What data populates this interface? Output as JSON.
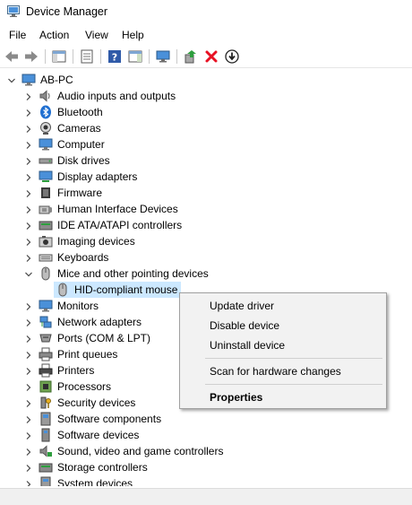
{
  "window": {
    "title": "Device Manager"
  },
  "menu": [
    "File",
    "Action",
    "View",
    "Help"
  ],
  "toolbar_icons": [
    "back-arrow-icon",
    "forward-arrow-icon",
    "show-hide-console-tree-icon",
    "properties-sheet-icon",
    "help-icon",
    "action-pane-icon",
    "monitor-icon",
    "update-driver-icon",
    "uninstall-device-icon",
    "download-icon"
  ],
  "tree": {
    "root": "AB-PC",
    "categories": [
      {
        "label": "Audio inputs and outputs",
        "icon": "speaker-icon"
      },
      {
        "label": "Bluetooth",
        "icon": "bluetooth-icon"
      },
      {
        "label": "Cameras",
        "icon": "camera-icon"
      },
      {
        "label": "Computer",
        "icon": "computer-icon"
      },
      {
        "label": "Disk drives",
        "icon": "disk-drive-icon"
      },
      {
        "label": "Display adapters",
        "icon": "display-adapter-icon"
      },
      {
        "label": "Firmware",
        "icon": "firmware-icon"
      },
      {
        "label": "Human Interface Devices",
        "icon": "hid-icon"
      },
      {
        "label": "IDE ATA/ATAPI controllers",
        "icon": "ide-controller-icon"
      },
      {
        "label": "Imaging devices",
        "icon": "imaging-icon"
      },
      {
        "label": "Keyboards",
        "icon": "keyboard-icon"
      },
      {
        "label": "Mice and other pointing devices",
        "icon": "mouse-icon",
        "expanded": true,
        "children": [
          {
            "label": "HID-compliant mouse",
            "icon": "mouse-icon",
            "selected": true
          }
        ]
      },
      {
        "label": "Monitors",
        "icon": "monitor-icon"
      },
      {
        "label": "Network adapters",
        "icon": "network-adapter-icon"
      },
      {
        "label": "Ports (COM & LPT)",
        "icon": "ports-icon"
      },
      {
        "label": "Print queues",
        "icon": "print-queue-icon"
      },
      {
        "label": "Printers",
        "icon": "printer-icon"
      },
      {
        "label": "Processors",
        "icon": "processor-icon"
      },
      {
        "label": "Security devices",
        "icon": "security-device-icon"
      },
      {
        "label": "Software components",
        "icon": "software-component-icon"
      },
      {
        "label": "Software devices",
        "icon": "software-device-icon"
      },
      {
        "label": "Sound, video and game controllers",
        "icon": "sound-controller-icon"
      },
      {
        "label": "Storage controllers",
        "icon": "storage-controller-icon"
      },
      {
        "label": "System devices",
        "icon": "system-device-icon"
      }
    ]
  },
  "context_menu": {
    "items": [
      {
        "label": "Update driver"
      },
      {
        "label": "Disable device"
      },
      {
        "label": "Uninstall device"
      },
      {
        "separator": true
      },
      {
        "label": "Scan for hardware changes"
      },
      {
        "separator": true
      },
      {
        "label": "Properties",
        "bold": true
      }
    ]
  },
  "colors": {
    "selection": "#cce8ff",
    "menu_bg": "#f2f2f2",
    "accent_blue": "#1f6fd1",
    "delete_red": "#e81123",
    "green": "#2e9e3e"
  }
}
